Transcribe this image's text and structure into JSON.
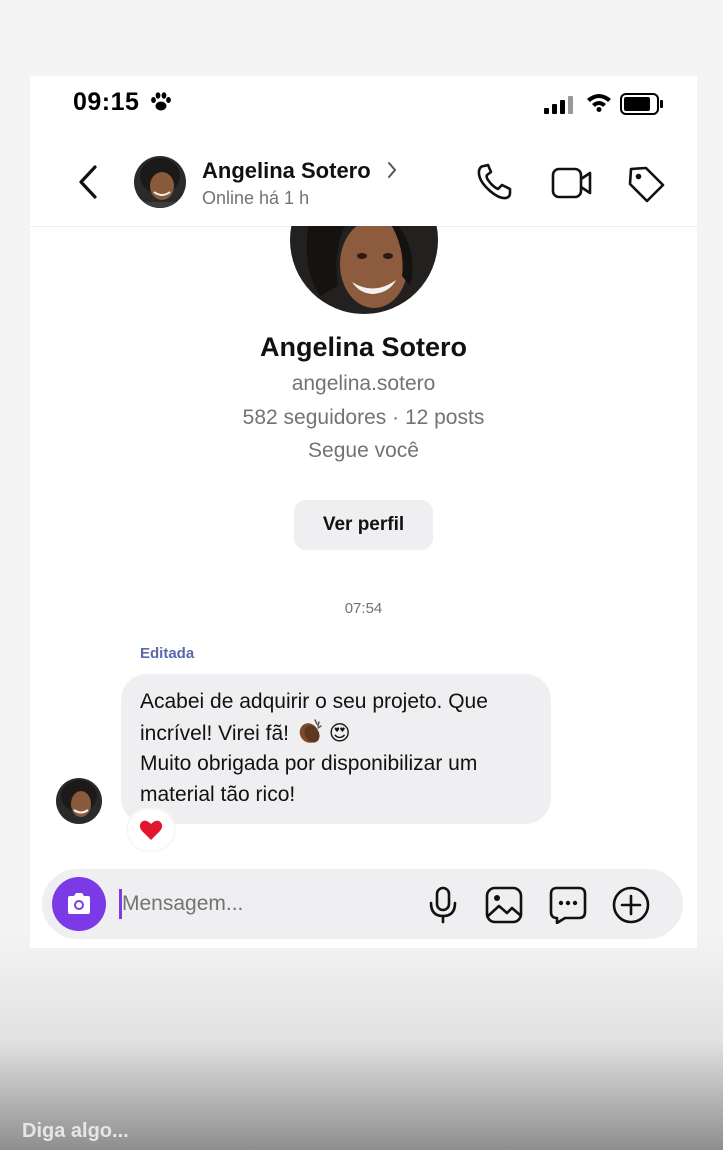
{
  "status_bar": {
    "time": "09:15"
  },
  "header": {
    "name": "Angelina Sotero",
    "status": "Online há 1 h"
  },
  "profile": {
    "name": "Angelina Sotero",
    "username": "angelina.sotero",
    "stats": "582 seguidores · 12 posts",
    "follows_you": "Segue você",
    "view_profile_label": "Ver perfil"
  },
  "conversation": {
    "timestamp": "07:54",
    "edited_label": "Editada",
    "message": {
      "line1": "Acabei de adquirir o seu projeto. Que",
      "line2": "incrível! Virei fã!",
      "line3": "Muito obrigada por disponibilizar um",
      "line4": "material tão rico!",
      "emoji_love": "😍",
      "reaction": "heart"
    }
  },
  "composer": {
    "placeholder": "Mensagem..."
  },
  "story_reply": {
    "placeholder": "Diga algo..."
  },
  "colors": {
    "accent": "#7b3ae6",
    "edited_label": "#5b68ad",
    "bubble": "#efeff1",
    "reaction_heart": "#e0172f"
  },
  "icons": [
    "paw-icon",
    "signal-icon",
    "wifi-icon",
    "battery-icon",
    "back-icon",
    "chevron-right-icon",
    "phone-icon",
    "video-icon",
    "tag-icon",
    "camera-icon",
    "mic-icon",
    "gallery-icon",
    "sticker-icon",
    "plus-icon",
    "heart-icon",
    "clap-icon"
  ]
}
